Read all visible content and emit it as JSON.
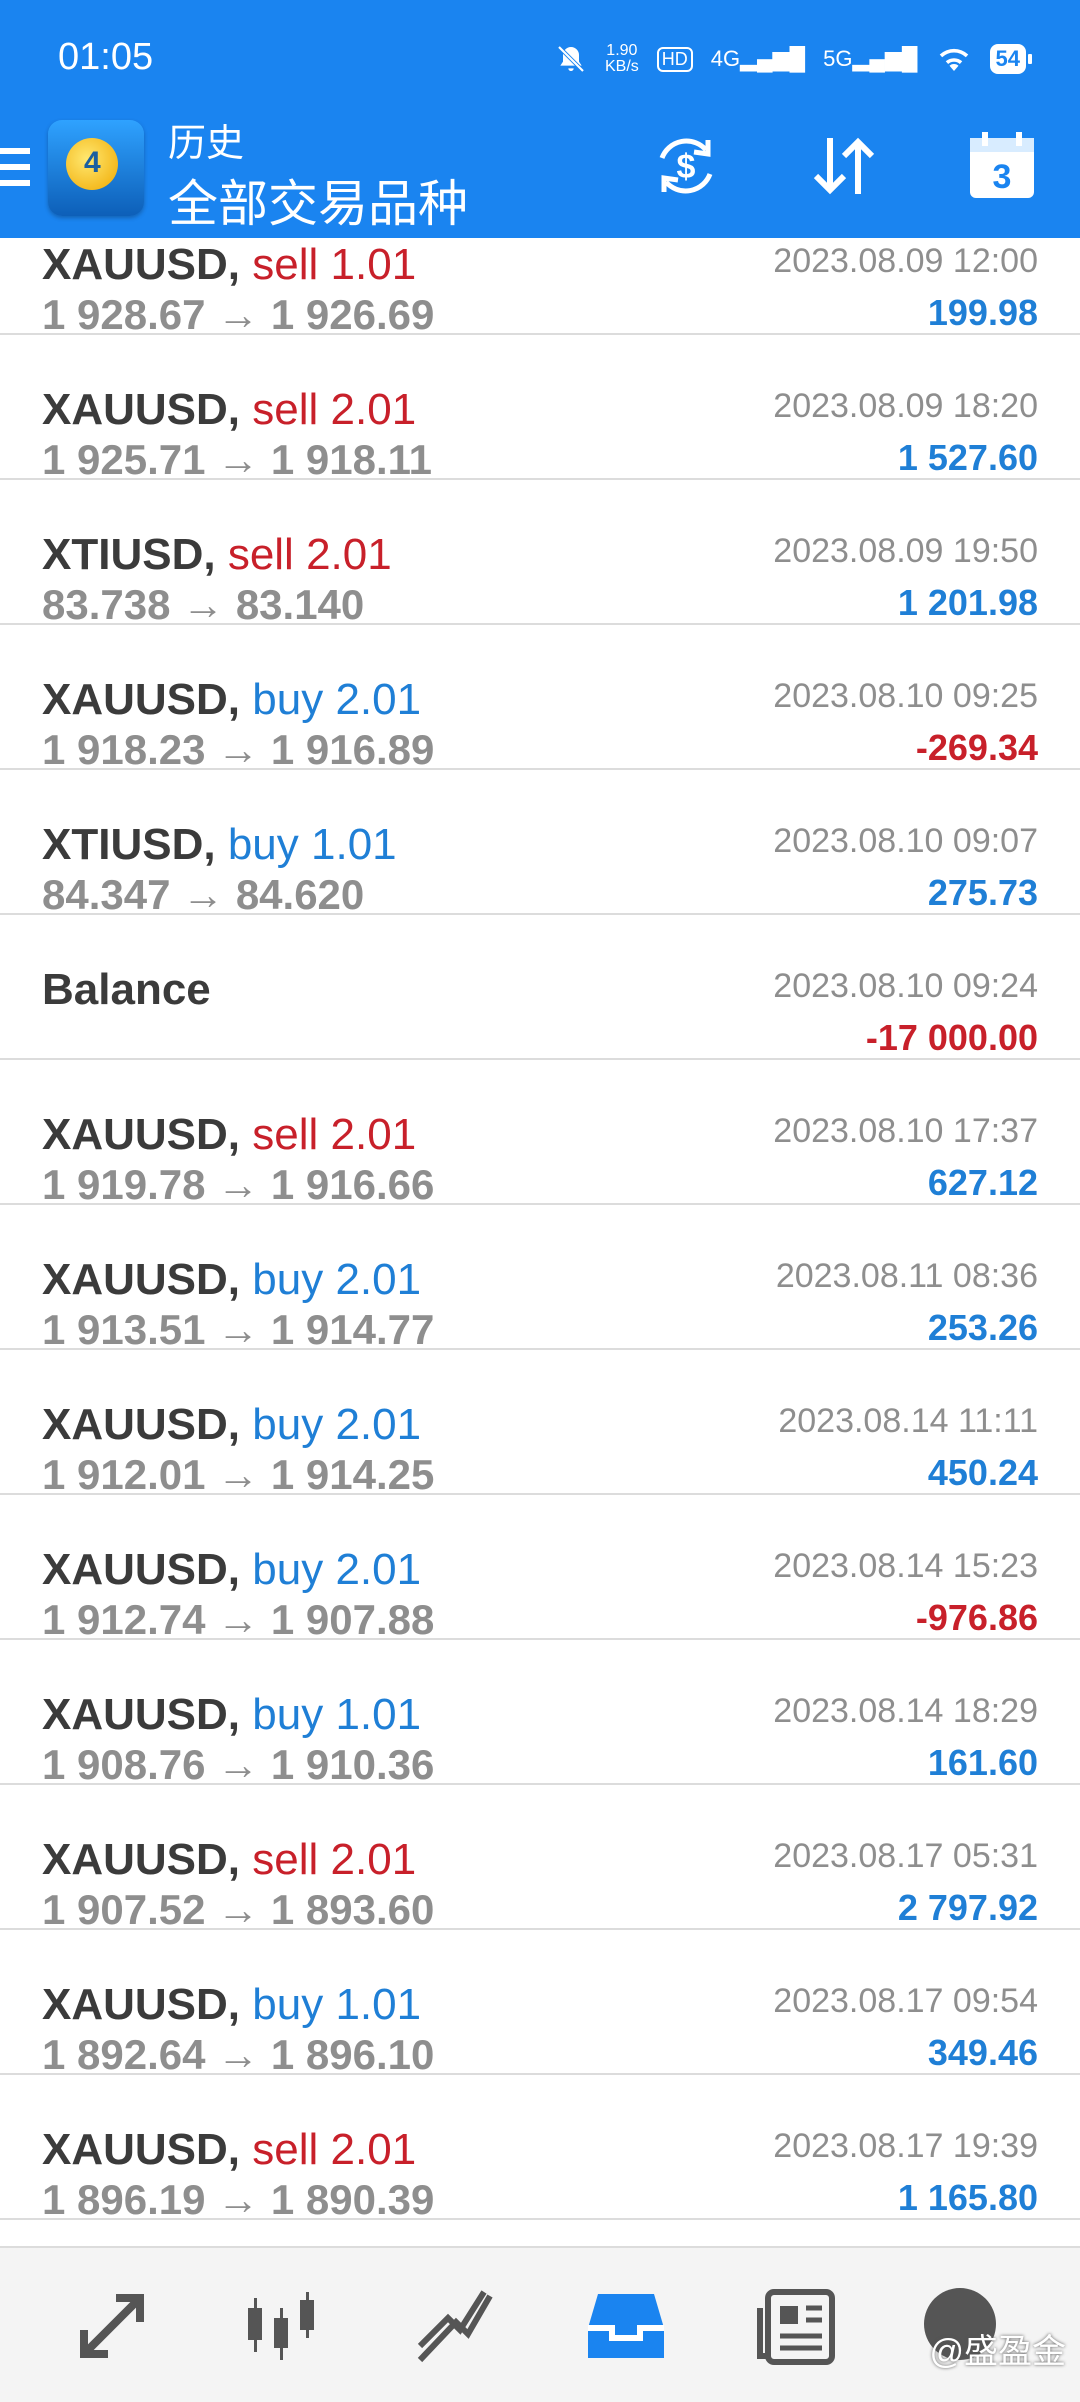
{
  "status_bar": {
    "time": "01:05",
    "speed_value": "1.90",
    "speed_unit": "KB/s",
    "hd_label": "HD",
    "net1": "4G",
    "net2": "5G",
    "battery": "54"
  },
  "header": {
    "title": "历史",
    "subtitle": "全部交易品种",
    "calendar_day": "3"
  },
  "trades": [
    {
      "symbol": "XAUUSD,",
      "side": "sell",
      "volume": "1.01",
      "open": "1 928.67",
      "close": "1 926.69",
      "time": "2023.08.09 12:00",
      "profit": "199.98",
      "profit_sign": "pos"
    },
    {
      "symbol": "XAUUSD,",
      "side": "sell",
      "volume": "2.01",
      "open": "1 925.71",
      "close": "1 918.11",
      "time": "2023.08.09 18:20",
      "profit": "1 527.60",
      "profit_sign": "pos"
    },
    {
      "symbol": "XTIUSD,",
      "side": "sell",
      "volume": "2.01",
      "open": "83.738",
      "close": "83.140",
      "time": "2023.08.09 19:50",
      "profit": "1 201.98",
      "profit_sign": "pos"
    },
    {
      "symbol": "XAUUSD,",
      "side": "buy",
      "volume": "2.01",
      "open": "1 918.23",
      "close": "1 916.89",
      "time": "2023.08.10 09:25",
      "profit": "-269.34",
      "profit_sign": "neg"
    },
    {
      "symbol": "XTIUSD,",
      "side": "buy",
      "volume": "1.01",
      "open": "84.347",
      "close": "84.620",
      "time": "2023.08.10 09:07",
      "profit": "275.73",
      "profit_sign": "pos"
    },
    {
      "symbol": "Balance",
      "side": "",
      "volume": "",
      "open": "",
      "close": "",
      "time": "2023.08.10 09:24",
      "profit": "-17 000.00",
      "profit_sign": "neg"
    },
    {
      "symbol": "XAUUSD,",
      "side": "sell",
      "volume": "2.01",
      "open": "1 919.78",
      "close": "1 916.66",
      "time": "2023.08.10 17:37",
      "profit": "627.12",
      "profit_sign": "pos"
    },
    {
      "symbol": "XAUUSD,",
      "side": "buy",
      "volume": "2.01",
      "open": "1 913.51",
      "close": "1 914.77",
      "time": "2023.08.11 08:36",
      "profit": "253.26",
      "profit_sign": "pos"
    },
    {
      "symbol": "XAUUSD,",
      "side": "buy",
      "volume": "2.01",
      "open": "1 912.01",
      "close": "1 914.25",
      "time": "2023.08.14 11:11",
      "profit": "450.24",
      "profit_sign": "pos"
    },
    {
      "symbol": "XAUUSD,",
      "side": "buy",
      "volume": "2.01",
      "open": "1 912.74",
      "close": "1 907.88",
      "time": "2023.08.14 15:23",
      "profit": "-976.86",
      "profit_sign": "neg"
    },
    {
      "symbol": "XAUUSD,",
      "side": "buy",
      "volume": "1.01",
      "open": "1 908.76",
      "close": "1 910.36",
      "time": "2023.08.14 18:29",
      "profit": "161.60",
      "profit_sign": "pos"
    },
    {
      "symbol": "XAUUSD,",
      "side": "sell",
      "volume": "2.01",
      "open": "1 907.52",
      "close": "1 893.60",
      "time": "2023.08.17 05:31",
      "profit": "2 797.92",
      "profit_sign": "pos"
    },
    {
      "symbol": "XAUUSD,",
      "side": "buy",
      "volume": "1.01",
      "open": "1 892.64",
      "close": "1 896.10",
      "time": "2023.08.17 09:54",
      "profit": "349.46",
      "profit_sign": "pos"
    },
    {
      "symbol": "XAUUSD,",
      "side": "sell",
      "volume": "2.01",
      "open": "1 896.19",
      "close": "1 890.39",
      "time": "2023.08.17 19:39",
      "profit": "1 165.80",
      "profit_sign": "pos"
    }
  ],
  "arrow": "→",
  "bottom_nav": [
    {
      "name": "quotes",
      "icon": "quotes-arrows-icon"
    },
    {
      "name": "chart",
      "icon": "candlestick-chart-icon"
    },
    {
      "name": "trade",
      "icon": "trend-lines-icon"
    },
    {
      "name": "history",
      "icon": "inbox-tray-icon",
      "active": true
    },
    {
      "name": "news",
      "icon": "newspaper-icon"
    },
    {
      "name": "messages",
      "icon": "chat-icon"
    }
  ],
  "watermark": "@盛盈金",
  "colors": {
    "header_bg": "#1a84f0",
    "sell": "#c8202a",
    "buy": "#1f7fd6",
    "profit_positive": "#1f7fd6",
    "profit_negative": "#c8202a",
    "active_nav": "#1a84f0"
  }
}
